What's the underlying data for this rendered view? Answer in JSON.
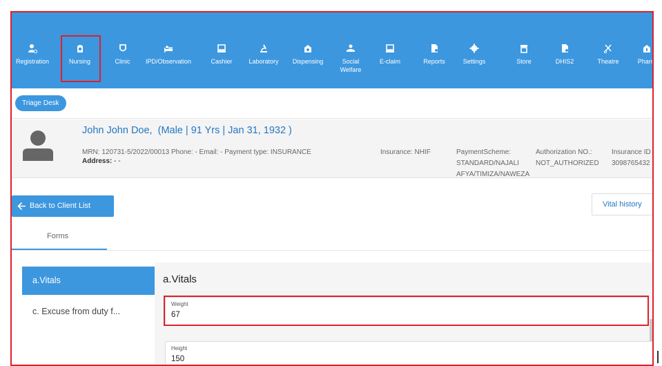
{
  "nav": {
    "items": [
      {
        "label": "Registration",
        "icon": "person-add-icon"
      },
      {
        "label": "Nursing",
        "icon": "nurse-icon"
      },
      {
        "label": "Clinic",
        "icon": "shield-icon"
      },
      {
        "label": "IPD/Observation",
        "icon": "bed-icon"
      },
      {
        "label": "Cashier",
        "icon": "cash-register-icon"
      },
      {
        "label": "Laboratory",
        "icon": "microscope-icon"
      },
      {
        "label": "Dispensing",
        "icon": "pharmacy-icon"
      },
      {
        "label": "Social",
        "label2": "Welfare",
        "icon": "welfare-icon"
      },
      {
        "label": "E-claim",
        "icon": "claim-icon"
      },
      {
        "label": "Reports",
        "icon": "report-icon"
      },
      {
        "label": "Settings",
        "icon": "gear-icon"
      },
      {
        "label": "Store",
        "icon": "store-icon"
      },
      {
        "label": "DHIS2",
        "icon": "document-icon"
      },
      {
        "label": "Theatre",
        "icon": "scissors-icon"
      },
      {
        "label": "Pharm",
        "icon": "pharmacy-icon"
      }
    ],
    "bg_color": "#3c97df"
  },
  "subbar": {
    "triage_label": "Triage Desk"
  },
  "patient": {
    "name": "John John Doe,",
    "details": "(Male | 91 Yrs | Jan 31, 1932 )",
    "mrn_line": "MRN: 120731-5/2022/00013   Phone: - Email: -   Payment type: INSURANCE",
    "insurance": "Insurance: NHIF",
    "scheme_label": "PaymentScheme:",
    "scheme_value1": "STANDARD/NAJALI",
    "scheme_value2": "AFYA/TIMIZA/NAWEZA",
    "auth_label": "Authorization NO.:",
    "auth_value": "NOT_AUTHORIZED",
    "insurance_id_label": "Insurance ID",
    "insurance_id_value": "3098765432",
    "address_label": "Address:",
    "address_value": " - -"
  },
  "actions": {
    "back": "Back to Client List",
    "vital_history": "Vital history"
  },
  "tabs": {
    "forms": "Forms"
  },
  "sidebar": {
    "items": [
      "a.Vitals",
      "c. Excuse from duty f..."
    ]
  },
  "form": {
    "title": "a.Vitals",
    "fields": [
      {
        "label": "Weight",
        "value": "67"
      },
      {
        "label": "Height",
        "value": "150"
      }
    ]
  }
}
